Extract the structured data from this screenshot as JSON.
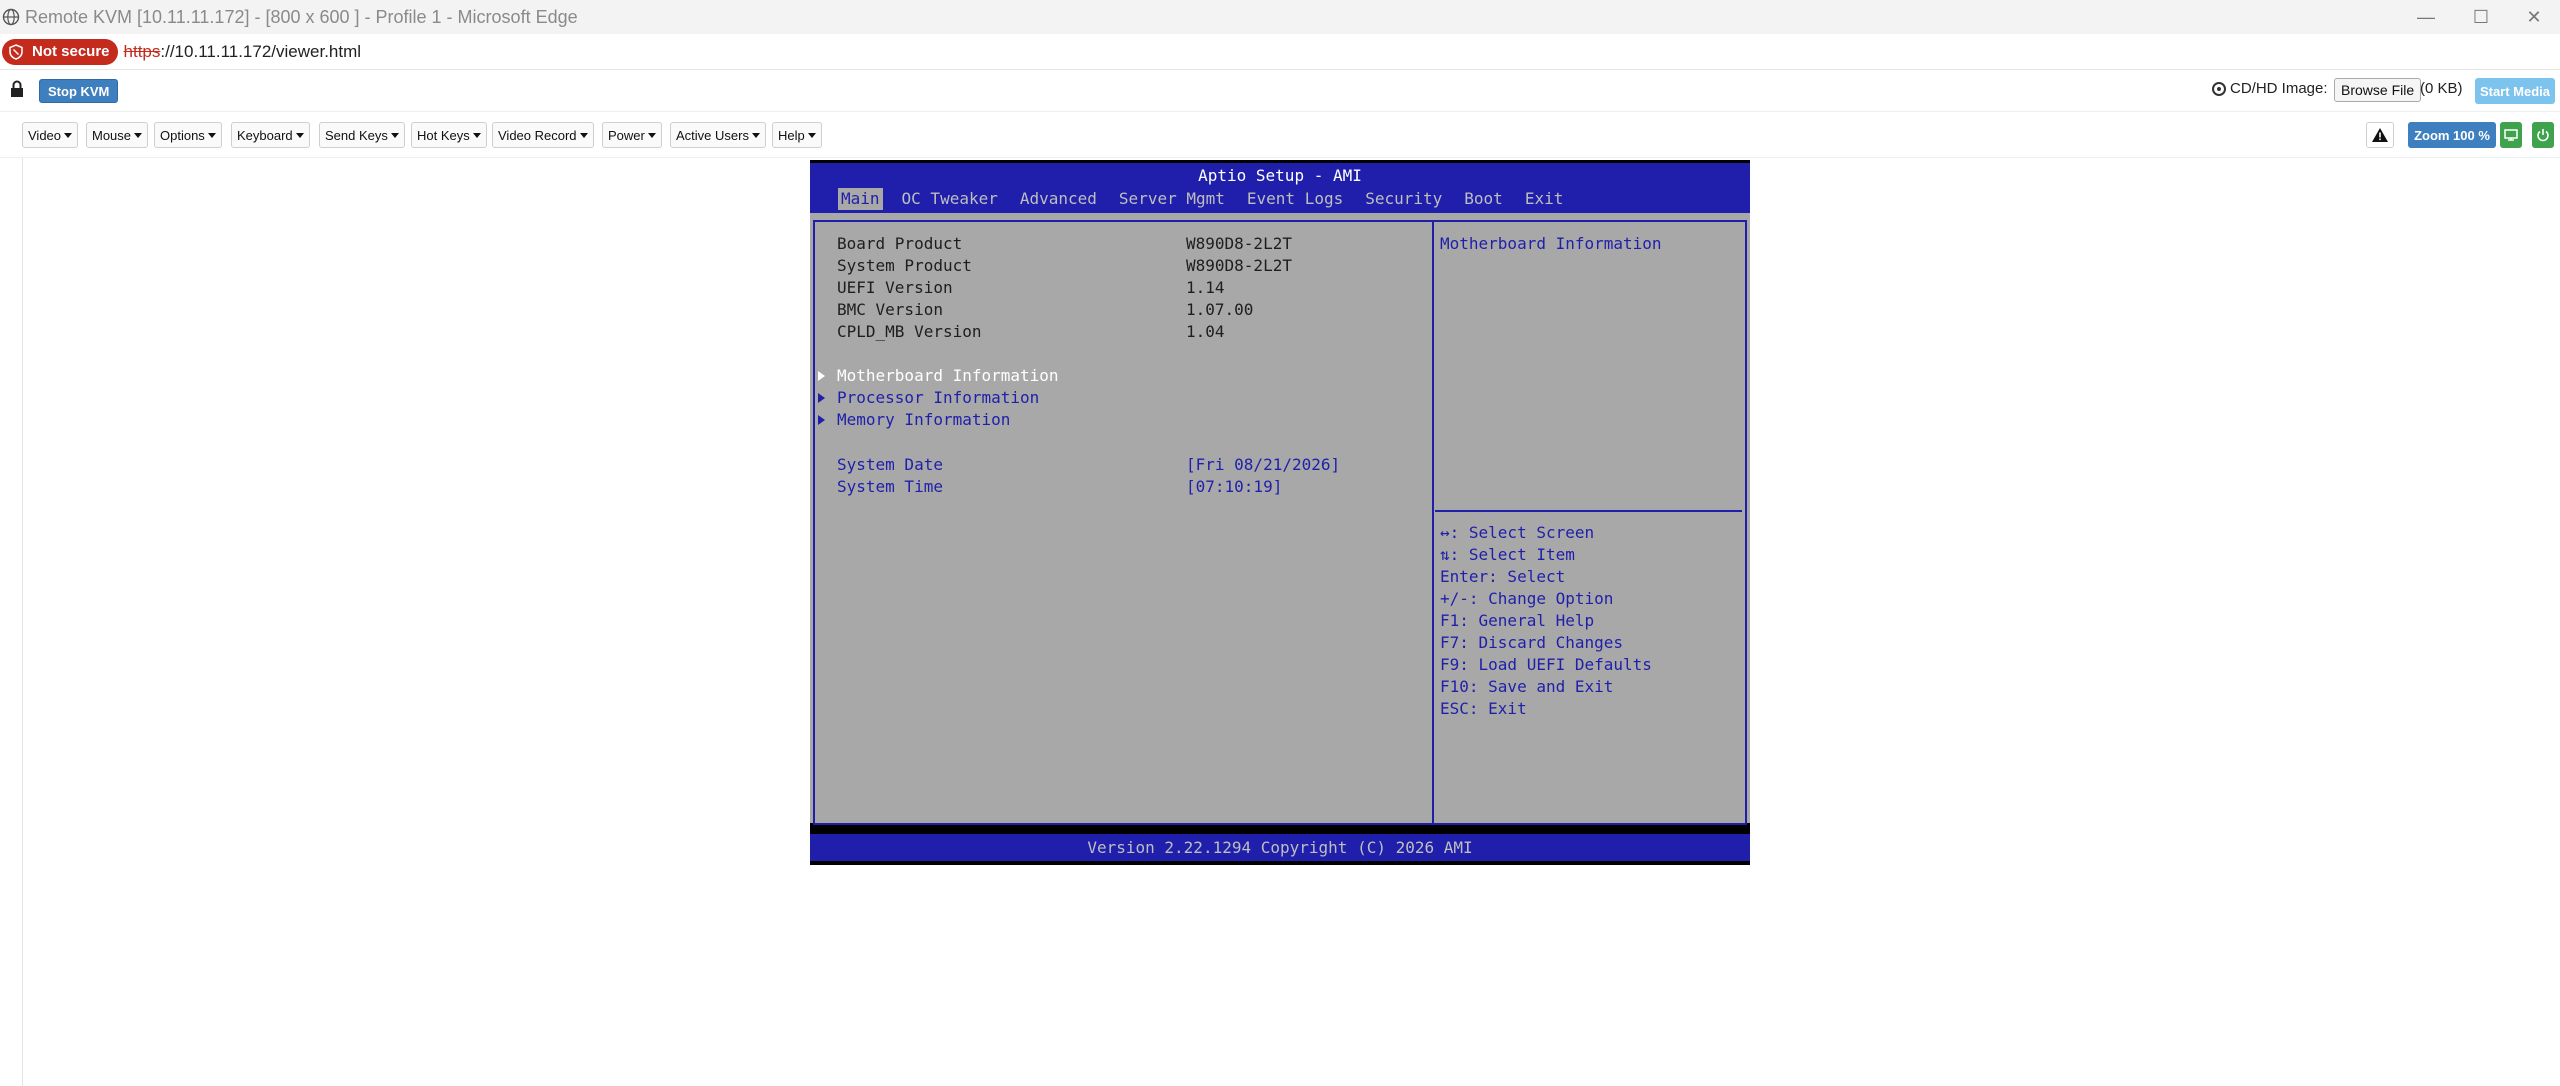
{
  "browser": {
    "title": "Remote KVM [10.11.11.172] - [800 x 600 ] - Profile 1 - Microsoft Edge",
    "not_secure": "Not secure",
    "url_proto": "https",
    "url_rest": "://10.11.11.172/viewer.html"
  },
  "kvm": {
    "stop_label": "Stop KVM",
    "cdhd_label": "CD/HD Image:",
    "browse_label": "Browse File",
    "size_label": "(0 KB)",
    "start_media_label": "Start Media",
    "zoom_label": "Zoom 100 %",
    "menus": [
      "Video",
      "Mouse",
      "Options",
      "Keyboard",
      "Send Keys",
      "Hot Keys",
      "Video Record",
      "Power",
      "Active Users",
      "Help"
    ]
  },
  "bios": {
    "header": "Aptio Setup - AMI",
    "tabs": [
      "Main",
      "OC Tweaker",
      "Advanced",
      "Server Mgmt",
      "Event Logs",
      "Security",
      "Boot",
      "Exit"
    ],
    "info": [
      {
        "label": "Board Product",
        "value": "W890D8-2L2T"
      },
      {
        "label": "System Product",
        "value": "W890D8-2L2T"
      },
      {
        "label": "UEFI Version",
        "value": "1.14"
      },
      {
        "label": "BMC Version",
        "value": "1.07.00"
      },
      {
        "label": "CPLD_MB Version",
        "value": "1.04"
      }
    ],
    "submenus": [
      "Motherboard Information",
      "Processor Information",
      "Memory Information"
    ],
    "date_label": "System Date",
    "date_value": "[Fri 08/21/2026]",
    "time_label": "System Time",
    "time_value": "[07:10:19]",
    "help_text": "Motherboard Information",
    "keys": [
      "↔: Select Screen",
      "⇅: Select Item",
      "Enter: Select",
      "+/-: Change Option",
      "F1: General Help",
      "F7: Discard Changes",
      "F9: Load UEFI Defaults",
      "F10: Save and Exit",
      "ESC: Exit"
    ],
    "footer": "Version 2.22.1294 Copyright (C) 2026 AMI",
    "colors": {
      "blue": "#1f1fab",
      "gray": "#a8a8a8",
      "white_text": "#ffffff"
    }
  }
}
